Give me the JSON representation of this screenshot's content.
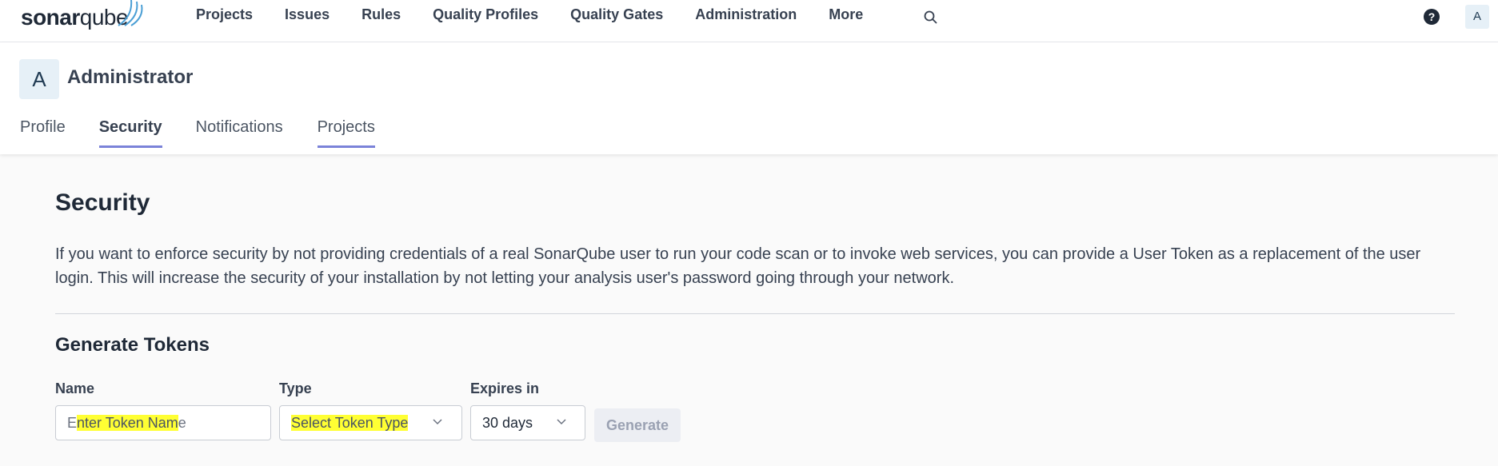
{
  "nav": {
    "logo": {
      "main": "sonar",
      "accent": "qube"
    },
    "items": [
      "Projects",
      "Issues",
      "Rules",
      "Quality Profiles",
      "Quality Gates",
      "Administration",
      "More"
    ],
    "help_label": "?",
    "avatar_letter": "A"
  },
  "account": {
    "avatar_letter": "A",
    "title": "Administrator",
    "tabs": [
      {
        "label": "Profile",
        "active": false
      },
      {
        "label": "Security",
        "active": true
      },
      {
        "label": "Notifications",
        "active": false
      },
      {
        "label": "Projects",
        "active": false
      }
    ]
  },
  "security": {
    "title": "Security",
    "description": "If you want to enforce security by not providing credentials of a real SonarQube user to run your code scan or to invoke web services, you can provide a User Token as a replacement of the user login. This will increase the security of your installation by not letting your analysis user's password going through your network.",
    "generate_title": "Generate Tokens",
    "form": {
      "name_label": "Name",
      "name_placeholder_start": "E",
      "name_placeholder_mid": "nter Token Nam",
      "name_placeholder_end": "e",
      "type_label": "Type",
      "type_placeholder": "Select Token Type",
      "expires_label": "Expires in",
      "expires_value": "30 days",
      "generate_label": "Generate"
    }
  },
  "colors": {
    "tab_underline": "#7b83d9",
    "highlight": "#ffff33"
  }
}
